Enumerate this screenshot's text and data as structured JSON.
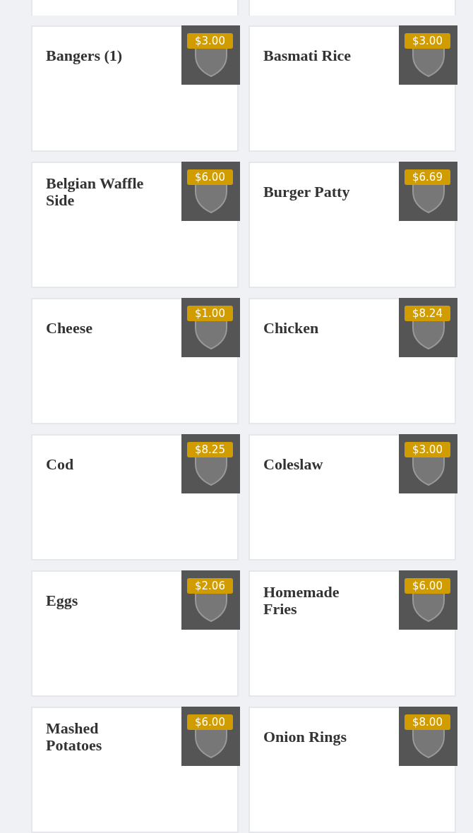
{
  "top_cards": [
    {
      "kind": "blank"
    },
    {
      "kind": "blank"
    }
  ],
  "items": [
    {
      "name": "Bangers (1)",
      "price": "$3.00"
    },
    {
      "name": "Basmati Rice",
      "price": "$3.00"
    },
    {
      "name": "Belgian Waffle Side",
      "price": "$6.00"
    },
    {
      "name": "Burger Patty",
      "price": "$6.69"
    },
    {
      "name": "Cheese",
      "price": "$1.00"
    },
    {
      "name": "Chicken",
      "price": "$8.24"
    },
    {
      "name": "Cod",
      "price": "$8.25"
    },
    {
      "name": "Coleslaw",
      "price": "$3.00"
    },
    {
      "name": "Eggs",
      "price": "$2.06"
    },
    {
      "name": "Homemade Fries",
      "price": "$6.00"
    },
    {
      "name": "Mashed Potatoes",
      "price": "$6.00"
    },
    {
      "name": "Onion Rings",
      "price": "$8.00"
    }
  ]
}
